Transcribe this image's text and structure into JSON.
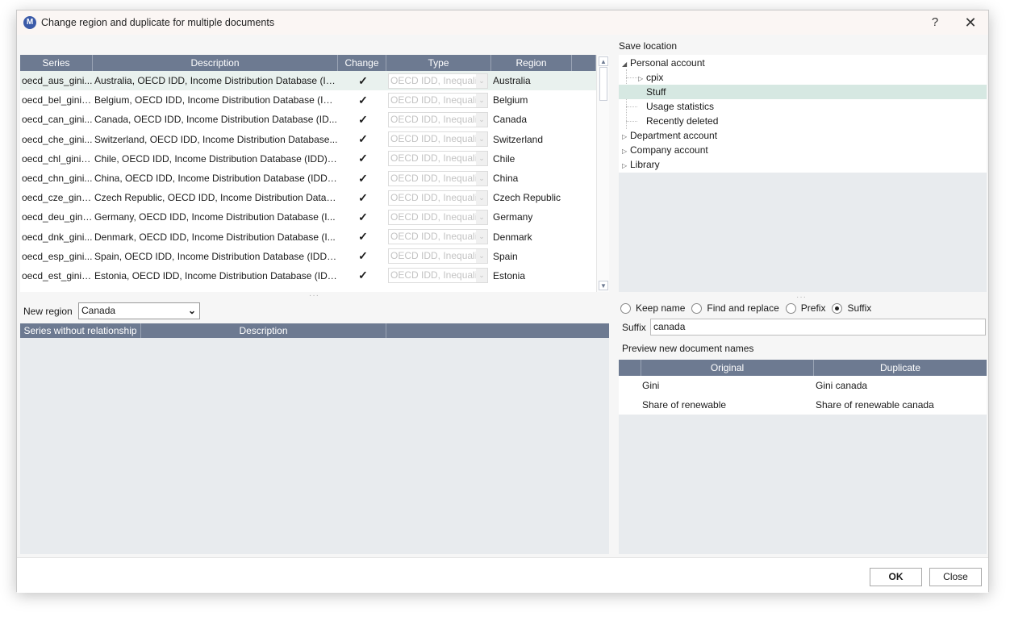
{
  "window": {
    "title": "Change region and duplicate for multiple documents",
    "help": "?",
    "close": "✕",
    "logo": "M"
  },
  "series_table": {
    "headers": [
      "Series",
      "Description",
      "Change",
      "Type",
      "Region"
    ],
    "rows": [
      {
        "series": "oecd_aus_gini...",
        "description": "Australia, OECD IDD, Income Distribution Database (ID...",
        "change": "✓",
        "type": "OECD IDD, Inequali",
        "region": "Australia"
      },
      {
        "series": "oecd_bel_gini_...",
        "description": "Belgium, OECD IDD, Income Distribution Database (ID...",
        "change": "✓",
        "type": "OECD IDD, Inequali",
        "region": "Belgium"
      },
      {
        "series": "oecd_can_gini...",
        "description": "Canada, OECD IDD, Income Distribution Database (ID...",
        "change": "✓",
        "type": "OECD IDD, Inequali",
        "region": "Canada"
      },
      {
        "series": "oecd_che_gini...",
        "description": "Switzerland, OECD IDD, Income Distribution Database...",
        "change": "✓",
        "type": "OECD IDD, Inequali",
        "region": "Switzerland"
      },
      {
        "series": "oecd_chl_gini_...",
        "description": "Chile, OECD IDD, Income Distribution Database (IDD),...",
        "change": "✓",
        "type": "OECD IDD, Inequali",
        "region": "Chile"
      },
      {
        "series": "oecd_chn_gini...",
        "description": "China, OECD IDD, Income Distribution Database (IDD),...",
        "change": "✓",
        "type": "OECD IDD, Inequali",
        "region": "China"
      },
      {
        "series": "oecd_cze_gini_...",
        "description": "Czech Republic, OECD IDD, Income Distribution Datab...",
        "change": "✓",
        "type": "OECD IDD, Inequali",
        "region": "Czech Republic"
      },
      {
        "series": "oecd_deu_gini...",
        "description": "Germany, OECD IDD, Income Distribution Database (I...",
        "change": "✓",
        "type": "OECD IDD, Inequali",
        "region": "Germany"
      },
      {
        "series": "oecd_dnk_gini...",
        "description": "Denmark, OECD IDD, Income Distribution Database (I...",
        "change": "✓",
        "type": "OECD IDD, Inequali",
        "region": "Denmark"
      },
      {
        "series": "oecd_esp_gini...",
        "description": "Spain, OECD IDD, Income Distribution Database (IDD),...",
        "change": "✓",
        "type": "OECD IDD, Inequali",
        "region": "Spain"
      },
      {
        "series": "oecd_est_gini_...",
        "description": "Estonia, OECD IDD, Income Distribution Database (IDD...",
        "change": "✓",
        "type": "OECD IDD, Inequali",
        "region": "Estonia"
      }
    ]
  },
  "new_region": {
    "label": "New region",
    "value": "Canada"
  },
  "without_relationship": {
    "headers": [
      "Series without relationship",
      "Description"
    ]
  },
  "save_location": {
    "label": "Save location",
    "tree": {
      "personal": "Personal account",
      "cpix": "cpix",
      "stuff": "Stuff",
      "usage": "Usage statistics",
      "deleted": "Recently deleted",
      "department": "Department account",
      "company": "Company account",
      "library": "Library"
    }
  },
  "naming": {
    "options": [
      "Keep name",
      "Find and replace",
      "Prefix",
      "Suffix"
    ],
    "selected": "Suffix",
    "suffix_label": "Suffix",
    "suffix_value": "canada",
    "preview_label": "Preview new document names",
    "preview_headers": [
      "Original",
      "Duplicate"
    ],
    "preview_rows": [
      {
        "original": "Gini",
        "duplicate": "Gini canada"
      },
      {
        "original": "Share of renewable",
        "duplicate": "Share of renewable canada"
      }
    ]
  },
  "buttons": {
    "ok": "OK",
    "close": "Close"
  }
}
